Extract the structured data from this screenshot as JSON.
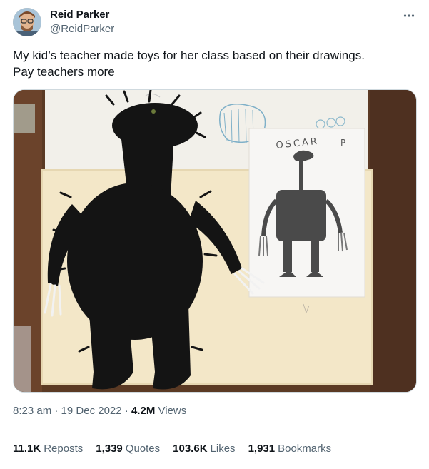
{
  "author": {
    "name": "Reid Parker",
    "handle": "@ReidParker_"
  },
  "tweet": {
    "lines": [
      "My kid’s teacher made toys for her class based on their drawings.",
      "Pay teachers more"
    ]
  },
  "media": {
    "drawing_label": "OSCAR",
    "drawing_mark": "P"
  },
  "meta": {
    "time": "8:23 am",
    "sep1": "·",
    "date": "19 Dec 2022",
    "sep2": "·",
    "views_count": "4.2M",
    "views_label": "Views"
  },
  "stats": [
    {
      "count": "11.1K",
      "label": "Reposts"
    },
    {
      "count": "1,339",
      "label": "Quotes"
    },
    {
      "count": "103.6K",
      "label": "Likes"
    },
    {
      "count": "1,931",
      "label": "Bookmarks"
    }
  ],
  "icons": {
    "more": "more-icon"
  }
}
